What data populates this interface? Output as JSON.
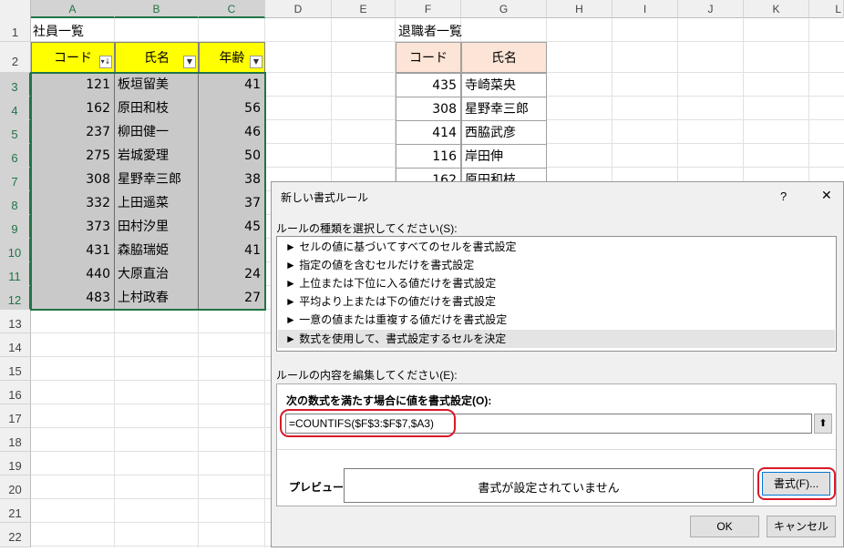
{
  "columns": [
    "A",
    "B",
    "C",
    "D",
    "E",
    "F",
    "G",
    "H",
    "I",
    "J",
    "K",
    "L"
  ],
  "rows": [
    "1",
    "2",
    "3",
    "4",
    "5",
    "6",
    "7",
    "8",
    "9",
    "10",
    "11",
    "12",
    "13",
    "14",
    "15",
    "16",
    "17",
    "18",
    "19",
    "20",
    "21",
    "22"
  ],
  "employees": {
    "title": "社員一覧",
    "headers": {
      "code": "コード",
      "name": "氏名",
      "age": "年齢"
    },
    "rows": [
      {
        "code": "121",
        "name": "板垣留美",
        "age": "41"
      },
      {
        "code": "162",
        "name": "原田和枝",
        "age": "56"
      },
      {
        "code": "237",
        "name": "柳田健一",
        "age": "46"
      },
      {
        "code": "275",
        "name": "岩城愛理",
        "age": "50"
      },
      {
        "code": "308",
        "name": "星野幸三郎",
        "age": "38"
      },
      {
        "code": "332",
        "name": "上田遥菜",
        "age": "37"
      },
      {
        "code": "373",
        "name": "田村汐里",
        "age": "45"
      },
      {
        "code": "431",
        "name": "森脇瑞姫",
        "age": "41"
      },
      {
        "code": "440",
        "name": "大原直治",
        "age": "24"
      },
      {
        "code": "483",
        "name": "上村政春",
        "age": "27"
      }
    ]
  },
  "retirees": {
    "title": "退職者一覧",
    "headers": {
      "code": "コード",
      "name": "氏名"
    },
    "rows": [
      {
        "code": "435",
        "name": "寺崎菜央"
      },
      {
        "code": "308",
        "name": "星野幸三郎"
      },
      {
        "code": "414",
        "name": "西脇武彦"
      },
      {
        "code": "116",
        "name": "岸田伸"
      },
      {
        "code": "162",
        "name": "原田和枝"
      }
    ]
  },
  "dialog": {
    "title": "新しい書式ルール",
    "help": "?",
    "close": "✕",
    "select_label": "ルールの種類を選択してください(S):",
    "rule_types": [
      "► セルの値に基づいてすべてのセルを書式設定",
      "► 指定の値を含むセルだけを書式設定",
      "► 上位または下位に入る値だけを書式設定",
      "► 平均より上または下の値だけを書式設定",
      "► 一意の値または重複する値だけを書式設定",
      "► 数式を使用して、書式設定するセルを決定"
    ],
    "edit_label": "ルールの内容を編集してください(E):",
    "formula_label": "次の数式を満たす場合に値を書式設定(O):",
    "formula_value": "=COUNTIFS($F$3:$F$7,$A3)",
    "collapse_icon": "⬆",
    "preview_label": "プレビュー:",
    "preview_text": "書式が設定されていません",
    "format_button": "書式(F)...",
    "ok": "OK",
    "cancel": "キャンセル"
  },
  "colors": {
    "header_yellow": "#ffff00",
    "header_peach": "#fce4d6",
    "selection_gray": "#c9c9c9",
    "excel_green": "#217346",
    "highlight_red": "#d7192a"
  }
}
